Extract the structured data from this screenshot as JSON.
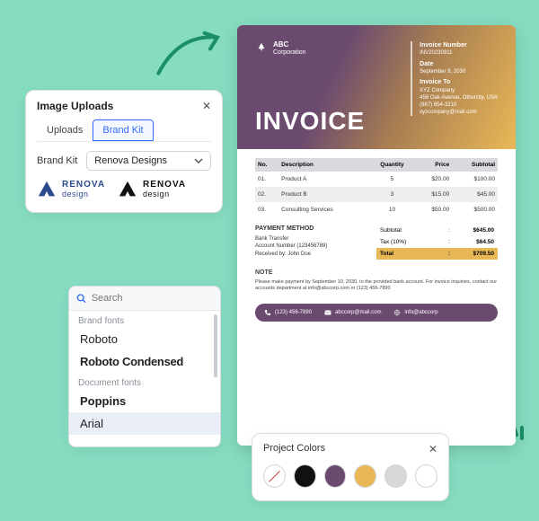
{
  "uploads": {
    "title": "Image Uploads",
    "tabs": [
      "Uploads",
      "Brand Kit"
    ],
    "active_tab": 1,
    "select_label": "Brand Kit",
    "select_value": "Renova Designs",
    "logo_name_top": "RENOVA",
    "logo_name_bottom": "design"
  },
  "fonts": {
    "search_placeholder": "Search",
    "group_brand": "Brand fonts",
    "group_doc": "Document fonts",
    "items_brand": [
      "Roboto",
      "Roboto Condensed"
    ],
    "items_doc": [
      "Poppins",
      "Arial"
    ],
    "selected": "Arial"
  },
  "invoice": {
    "brand_top": "ABC",
    "brand_bottom": "Corporation",
    "number_label": "Invoice Number",
    "number": "INV20230911",
    "date_label": "Date",
    "date": "September 9, 2030",
    "to_label": "Invoice To",
    "to_name": "XYZ Company",
    "to_addr": "456 Oak Avenue, Othercity, USA",
    "to_phone": "(987) 654-3210",
    "to_email": "xyzcompany@mail.com",
    "title": "INVOICE",
    "cols": {
      "no": "No.",
      "desc": "Description",
      "qty": "Quantity",
      "price": "Price",
      "sub": "Subtotal"
    },
    "rows": [
      {
        "no": "01.",
        "desc": "Product A",
        "qty": "5",
        "price": "$20.00",
        "sub": "$100.00"
      },
      {
        "no": "02.",
        "desc": "Product B",
        "qty": "3",
        "price": "$15.00",
        "sub": "$45.00"
      },
      {
        "no": "03.",
        "desc": "Consulting Services",
        "qty": "10",
        "price": "$50.00",
        "sub": "$500.00"
      }
    ],
    "pay_title": "PAYMENT METHOD",
    "pay_1": "Bank Transfer",
    "pay_2": "Account Number (123456789)",
    "pay_3": "Received by: John Doe",
    "subtotal_label": "Subtotal",
    "subtotal": "$645.00",
    "tax_label": "Tax (10%)",
    "tax": "$64.50",
    "total_label": "Total",
    "total": "$709.50",
    "colon": ":",
    "note_label": "NOTE",
    "note_text": "Please make payment by September 10, 2030, to the provided bank account. For invoice inquiries, contact our accounts department at info@abccorp.com or (123) 456-7890",
    "phone": "(123) 456-7890",
    "email": "abccorp@mail.com",
    "site": "info@abccorp"
  },
  "colors": {
    "title": "Project Colors",
    "swatches": [
      "none",
      "#111111",
      "#6B4A70",
      "#E9B856",
      "#D8D8D8",
      "#FFFFFF"
    ]
  }
}
